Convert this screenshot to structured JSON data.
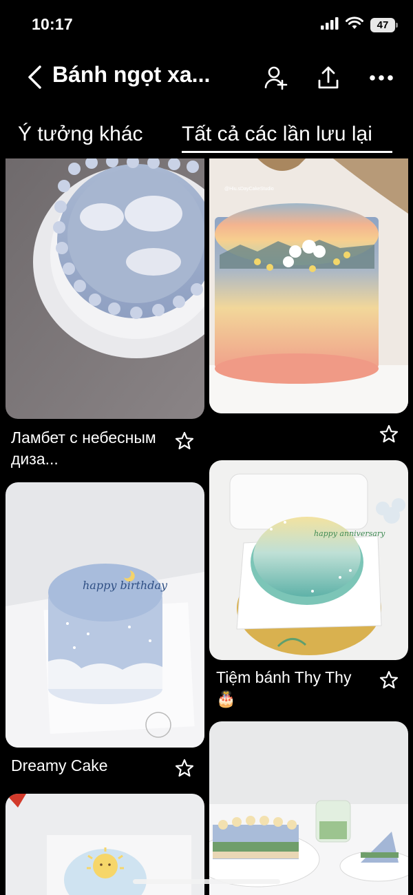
{
  "status": {
    "time": "10:17",
    "battery": "47"
  },
  "header": {
    "title": "Bánh ngọt xa..."
  },
  "tabs": [
    {
      "label": "Ý tưởng khác"
    },
    {
      "label": "Tất cả các lần lưu lại"
    }
  ],
  "pins": [
    {
      "title": "Ламбет с небесным диза..."
    },
    {
      "title": ""
    },
    {
      "title": "Dreamy Cake"
    },
    {
      "title": "Tiệm bánh Thy Thy 🎂"
    },
    {
      "title": ""
    },
    {
      "title": ""
    }
  ],
  "watermark": "@Hiu.sDayCakeStudio",
  "cake_text": {
    "birthday": "happy birthday",
    "anniversary": "happy anniversary"
  }
}
